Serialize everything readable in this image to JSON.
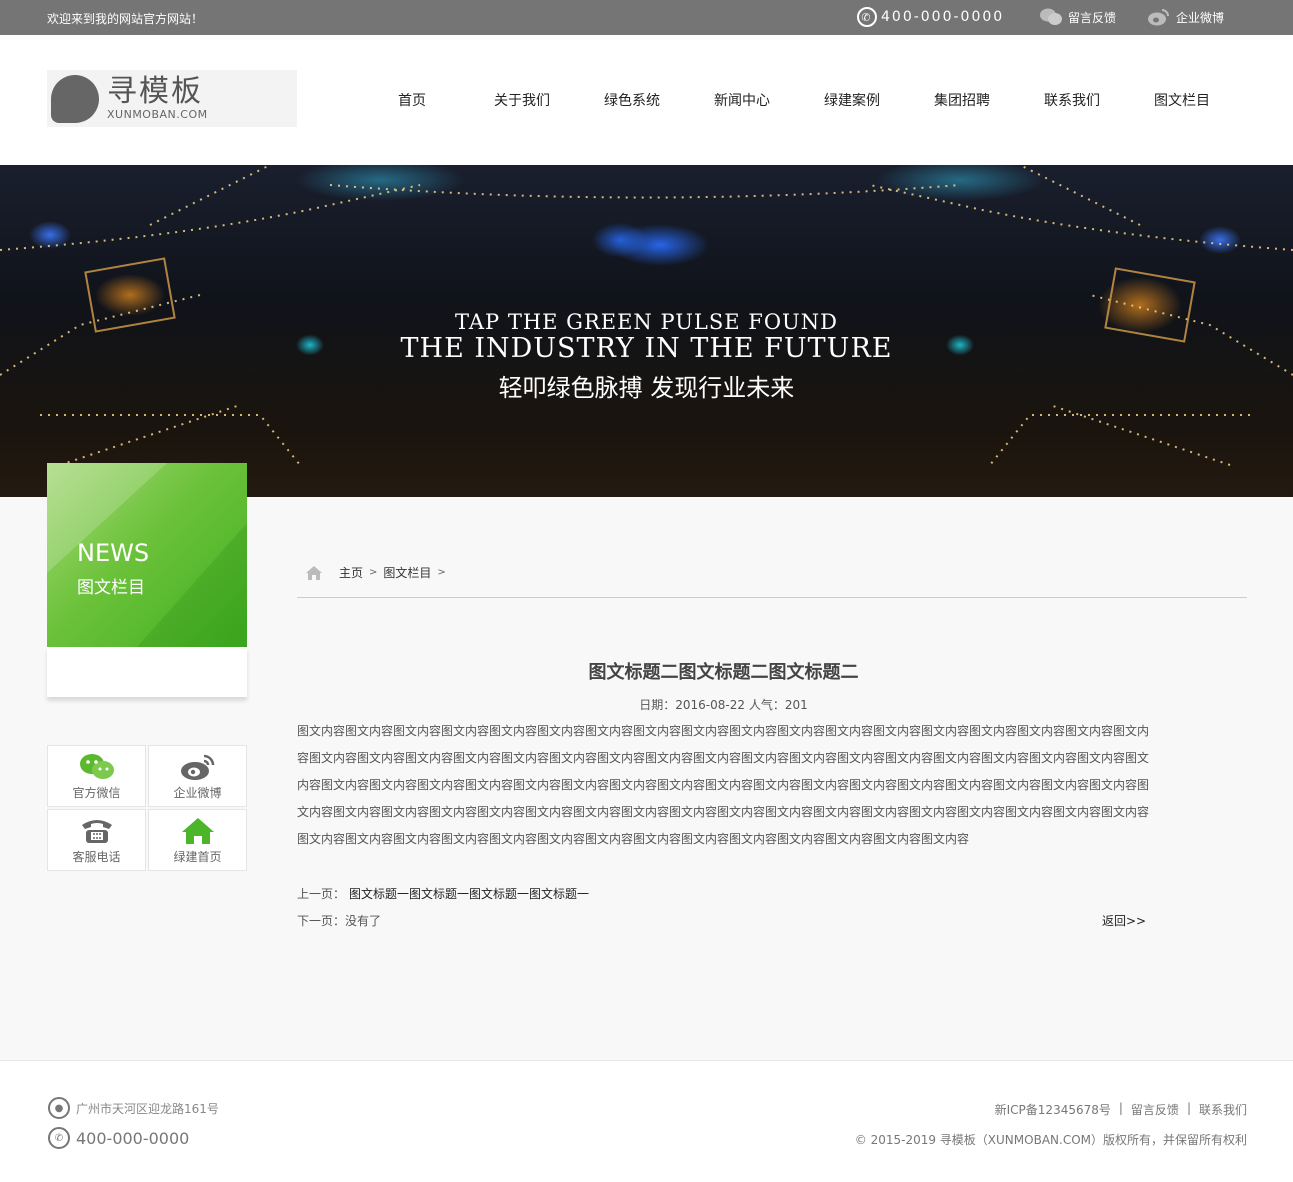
{
  "topbar": {
    "welcome": "欢迎来到我的网站官方网站！",
    "phone": "400-000-0000",
    "feedback": "留言反馈",
    "weibo": "企业微博"
  },
  "logo": {
    "cn": "寻模板",
    "en": "XUNMOBAN.COM"
  },
  "nav": {
    "items": [
      "首页",
      "关于我们",
      "绿色系统",
      "新闻中心",
      "绿建案例",
      "集团招聘",
      "联系我们",
      "图文栏目"
    ]
  },
  "banner": {
    "en_line1": "TAP THE GREEN PULSE FOUND",
    "en_line2": "THE INDUSTRY IN THE FUTURE",
    "cn_line": "轻叩绿色脉搏 发现行业未来"
  },
  "sidebar": {
    "heading_en": "NEWS",
    "heading_cn": "图文栏目",
    "quick": [
      {
        "label": "官方微信",
        "icon": "wechat-icon"
      },
      {
        "label": "企业微博",
        "icon": "weibo-icon"
      },
      {
        "label": "客服电话",
        "icon": "telephone-icon"
      },
      {
        "label": "绿建首页",
        "icon": "home-icon"
      }
    ],
    "accent": "#4cb52a"
  },
  "breadcrumb": {
    "home": "主页",
    "current": "图文栏目",
    "sep": ">"
  },
  "article": {
    "title": "图文标题二图文标题二图文标题二",
    "meta": "日期：2016-08-22  人气：201",
    "body": "图文内容图文内容图文内容图文内容图文内容图文内容图文内容图文内容图文内容图文内容图文内容图文内容图文内容图文内容图文内容图文内容图文内容图文内容图文内容图文内容图文内容图文内容图文内容图文内容图文内容图文内容图文内容图文内容图文内容图文内容图文内容图文内容图文内容图文内容图文内容图文内容图文内容图文内容图文内容图文内容图文内容图文内容图文内容图文内容图文内容图文内容图文内容图文内容图文内容图文内容图文内容图文内容图文内容图文内容图文内容图文内容图文内容图文内容图文内容图文内容图文内容图文内容图文内容图文内容图文内容图文内容图文内容图文内容图文内容图文内容图文内容图文内容图文内容图文内容图文内容图文内容图文内容图文内容图文内容图文内容图文内容图文内容图文内容图文内容图文内容"
  },
  "pager": {
    "prev_label": "上一页：",
    "prev_link": "图文标题一图文标题一图文标题一图文标题一",
    "next_label": "下一页：没有了",
    "back": "返回>>"
  },
  "footer": {
    "address": "广州市天河区迎龙路161号",
    "tel": "400-000-0000",
    "icp": "新ICP备12345678号",
    "feedback": "留言反馈",
    "contact": "联系我们",
    "sep": "|",
    "copyright": "© 2015-2019 寻模板（XUNMOBAN.COM）版权所有，并保留所有权利"
  }
}
